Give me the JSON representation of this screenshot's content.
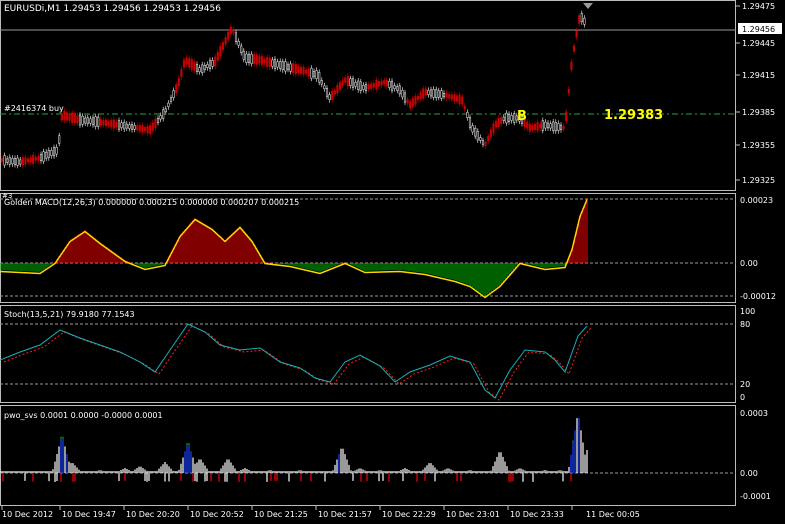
{
  "main": {
    "header": "EURUSDi,M1  1.29453 1.29456 1.29453 1.29456",
    "order_label": "#2416374 buy",
    "order_marker": "B",
    "order_price": "1.29383",
    "current_price": "1.29456",
    "ticks": [
      "1.29475",
      "1.29445",
      "1.29415",
      "1.29385",
      "1.29355",
      "1.29325"
    ]
  },
  "macd": {
    "header": "Golden MACD(12,26,3) 0.000000 0.000215 0.000000 0.000207 0.000215",
    "window_index": "#3",
    "ticks": [
      "0.00023",
      "0.00",
      "-0.00012"
    ]
  },
  "stoch": {
    "header": "Stoch(13,5,21) 79.9180 77.1543",
    "ticks": [
      "100",
      "80",
      "20",
      "0"
    ]
  },
  "pwo": {
    "header": "pwo_svs 0.0001 0.0000 -0.0000 0.0001",
    "ticks": [
      "0.0003",
      "0.00",
      "-0.0001"
    ]
  },
  "time_axis": [
    "10 Dec 2012",
    "10 Dec 19:47",
    "10 Dec 20:20",
    "10 Dec 20:52",
    "10 Dec 21:25",
    "10 Dec 21:57",
    "10 Dec 22:29",
    "10 Dec 23:01",
    "10 Dec 23:33",
    "11 Dec 00:05"
  ],
  "colors": {
    "background": "#000000",
    "candle": "#ffffff",
    "bear": "#cc0000",
    "order_line": "#2ea043",
    "order_text": "#ffff00",
    "macd_bull": "#ff0000",
    "macd_bear": "#00c000",
    "macd_signal": "#ffd700",
    "stoch_main": "#19b0b8",
    "stoch_signal": "#ff2020",
    "pwo_white": "#ffffff",
    "pwo_blue": "#1840ff",
    "pwo_green": "#00b000",
    "pwo_red": "#ff0000",
    "axis_text": "#ffffff"
  }
}
